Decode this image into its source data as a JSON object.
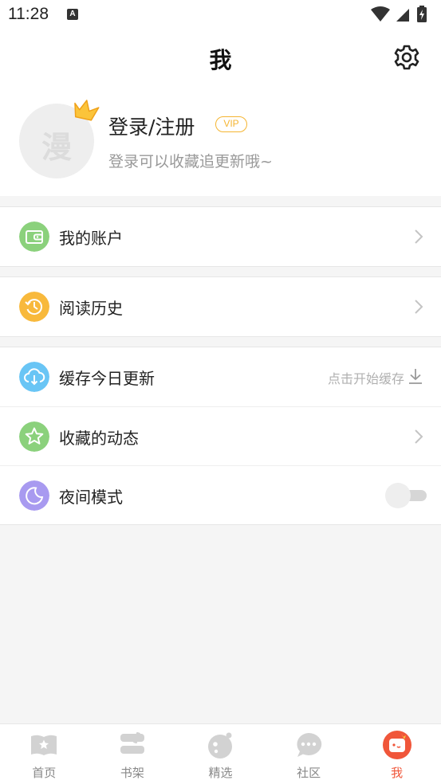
{
  "status_bar": {
    "time": "11:28",
    "notification_icon": "A"
  },
  "header": {
    "title": "我"
  },
  "profile": {
    "avatar_char": "漫",
    "login_title": "登录/注册",
    "vip_badge": "VIP",
    "subtitle": "登录可以收藏追更新哦~"
  },
  "menu": {
    "account": {
      "label": "我的账户",
      "icon": "wallet-icon",
      "color": "#8bd17c"
    },
    "history": {
      "label": "阅读历史",
      "icon": "clock-icon",
      "color": "#f8b93c"
    },
    "cache": {
      "label": "缓存今日更新",
      "hint": "点击开始缓存",
      "icon": "cloud-download-icon",
      "color": "#69c5f5"
    },
    "favorites": {
      "label": "收藏的动态",
      "icon": "star-icon",
      "color": "#8bd17c"
    },
    "night": {
      "label": "夜间模式",
      "icon": "moon-icon",
      "color": "#a89af0",
      "enabled": false
    }
  },
  "tabs": [
    {
      "label": "首页",
      "icon": "home-book-icon",
      "active": false
    },
    {
      "label": "书架",
      "icon": "shelf-icon",
      "active": false
    },
    {
      "label": "精选",
      "icon": "featured-icon",
      "active": false
    },
    {
      "label": "社区",
      "icon": "chat-icon",
      "active": false
    },
    {
      "label": "我",
      "icon": "me-icon",
      "active": true
    }
  ],
  "colors": {
    "accent": "#f0563a",
    "vip": "#f5b532"
  }
}
